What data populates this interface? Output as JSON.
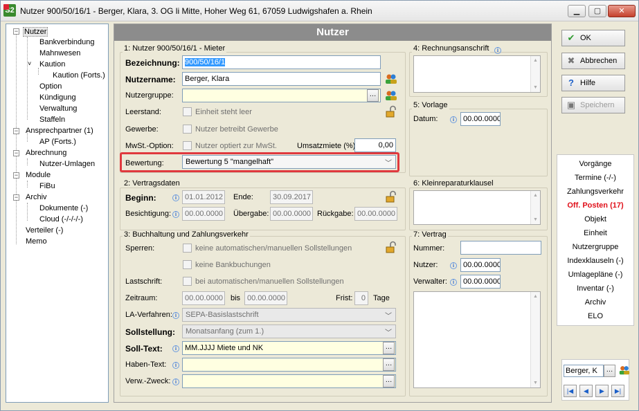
{
  "window": {
    "title": "Nutzer 900/50/16/1 - Berger, Klara, 3. OG li Mitte, Hoher Weg 61, 67059 Ludwigshafen a. Rhein",
    "app_icon": "S2",
    "minimize": "▁",
    "maximize": "▢",
    "close": "✕"
  },
  "tree": {
    "items": [
      {
        "label": "Nutzer"
      },
      {
        "label": "Bankverbindung"
      },
      {
        "label": "Mahnwesen"
      },
      {
        "label": "Kaution"
      },
      {
        "label": "Kaution (Forts.)"
      },
      {
        "label": "Option"
      },
      {
        "label": "Kündigung"
      },
      {
        "label": "Verwaltung"
      },
      {
        "label": "Staffeln"
      },
      {
        "label": "Ansprechpartner (1)"
      },
      {
        "label": "AP (Forts.)"
      },
      {
        "label": "Abrechnung"
      },
      {
        "label": "Nutzer-Umlagen"
      },
      {
        "label": "Module"
      },
      {
        "label": "FiBu"
      },
      {
        "label": "Archiv"
      },
      {
        "label": "Dokumente (-)"
      },
      {
        "label": "Cloud (-/-/-/-)"
      },
      {
        "label": "Verteiler (-)"
      },
      {
        "label": "Memo"
      }
    ]
  },
  "header": {
    "title": "Nutzer"
  },
  "section1": {
    "title": "1: Nutzer 900/50/16/1 - Mieter",
    "bezeichnung_label": "Bezeichnung:",
    "bezeichnung_value": "900/50/16/1",
    "nutzername_label": "Nutzername:",
    "nutzername_value": "Berger, Klara",
    "nutzergruppe_label": "Nutzergruppe:",
    "nutzergruppe_value": "",
    "leerstand_label": "Leerstand:",
    "leerstand_check": "Einheit steht leer",
    "gewerbe_label": "Gewerbe:",
    "gewerbe_check": "Nutzer betreibt Gewerbe",
    "mwst_label": "MwSt.-Option:",
    "mwst_check": "Nutzer optiert zur MwSt.",
    "umsatzmiete_label": "Umsatzmiete (%):",
    "umsatzmiete_value": "0,00",
    "bewertung_label": "Bewertung:",
    "bewertung_value": "Bewertung 5 \"mangelhaft\""
  },
  "section2": {
    "title": "2: Vertragsdaten",
    "beginn_label": "Beginn:",
    "beginn_value": "01.01.2012",
    "ende_label": "Ende:",
    "ende_value": "30.09.2017",
    "besichtigung_label": "Besichtigung:",
    "besichtigung_value": "00.00.0000",
    "uebergabe_label": "Übergabe:",
    "uebergabe_value": "00.00.0000",
    "rueckgabe_label": "Rückgabe:",
    "rueckgabe_value": "00.00.0000"
  },
  "section3": {
    "title": "3: Buchhaltung und Zahlungsverkehr",
    "sperren_label": "Sperren:",
    "sperren_check1": "keine automatischen/manuellen Sollstellungen",
    "sperren_check2": "keine Bankbuchungen",
    "lastschrift_label": "Lastschrift:",
    "lastschrift_check": "bei automatischen/manuellen Sollstellungen",
    "zeitraum_label": "Zeitraum:",
    "zeitraum_from": "00.00.0000",
    "zeitraum_bis": "bis",
    "zeitraum_to": "00.00.0000",
    "frist_label": "Frist:",
    "frist_value": "0",
    "tage_label": "Tage",
    "la_label": "LA-Verfahren:",
    "la_value": "SEPA-Basislastschrift",
    "sollstellung_label": "Sollstellung:",
    "sollstellung_value": "Monatsanfang (zum 1.)",
    "solltext_label": "Soll-Text:",
    "solltext_value": "MM.JJJJ Miete und NK",
    "habentext_label": "Haben-Text:",
    "habentext_value": "",
    "verwzweck_label": "Verw.-Zweck:",
    "verwzweck_value": ""
  },
  "section4": {
    "title": "4: Rechnungsanschrift"
  },
  "section5": {
    "title": "5: Vorlage",
    "datum_label": "Datum:",
    "datum_value": "00.00.0000"
  },
  "section6": {
    "title": "6: Kleinreparaturklausel"
  },
  "section7": {
    "title": "7: Vertrag",
    "nummer_label": "Nummer:",
    "nummer_value": "",
    "nutzer_label": "Nutzer:",
    "nutzer_value": "00.00.0000",
    "verwalter_label": "Verwalter:",
    "verwalter_value": "00.00.0000"
  },
  "actions": {
    "ok": "OK",
    "cancel": "Abbrechen",
    "help": "Hilfe",
    "save": "Speichern"
  },
  "nav": {
    "items": [
      "Vorgänge",
      "Termine (-/-)",
      "Zahlungsverkehr",
      "Off. Posten (17)",
      "Objekt",
      "Einheit",
      "Nutzergruppe",
      "Indexklauseln (-)",
      "Umlagepläne (-)",
      "Inventar (-)",
      "Archiv",
      "ELO"
    ],
    "highlight_color": "#e0101a"
  },
  "bottom": {
    "search_value": "Berger, K",
    "first": "|◀",
    "prev": "◀",
    "next": "▶",
    "last": "▶|"
  },
  "colors": {
    "header_bg": "#8c8c8c",
    "highlight_border": "#e0393e",
    "selection": "#3399ff"
  }
}
